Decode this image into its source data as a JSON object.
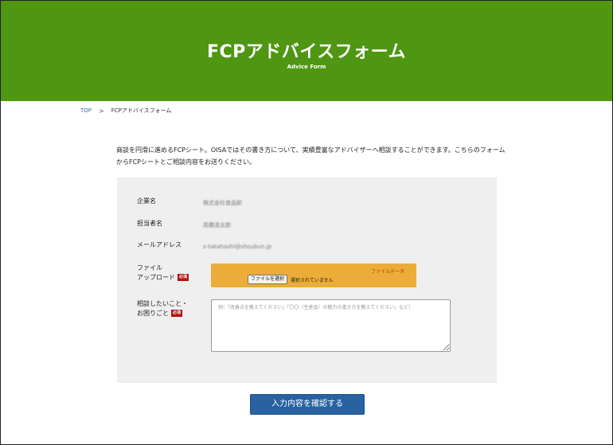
{
  "hero": {
    "title": "FCPアドバイスフォーム",
    "subtitle": "Advice Form",
    "background_color": "#4f9612"
  },
  "breadcrumb": {
    "home": "TOP",
    "separator": ">",
    "current": "FCPアドバイスフォーム"
  },
  "intro": {
    "text": "商談を円滑に進めるFCPシート。OISAではその書き方について、実績豊富なアドバイザーへ相談することができます。こちらのフォームからFCPシートとご相談内容をお送りください。"
  },
  "form": {
    "company": {
      "label": "企業名",
      "value": "株式会社食品卸"
    },
    "contact": {
      "label": "担当者名",
      "value": "高橋清太郎"
    },
    "email": {
      "label": "メールアドレス",
      "value": "s-takahashi@shoubun.jp"
    },
    "upload": {
      "label_line1": "ファイル",
      "label_line2": "アップロード",
      "required": "必須",
      "hint": "ファイルデータ",
      "button_label": "ファイルを選択",
      "status": "選択されていません",
      "box_color": "#ecad38"
    },
    "consult": {
      "label_line1": "相談したいこと・",
      "label_line2": "お困りごと",
      "required": "必須",
      "placeholder": "例：「改善点を教えてください」「〇〇（生産品）の魅力の書き方を教えてください」など）"
    }
  },
  "submit": {
    "label": "入力内容を確認する",
    "color": "#2862a0"
  }
}
